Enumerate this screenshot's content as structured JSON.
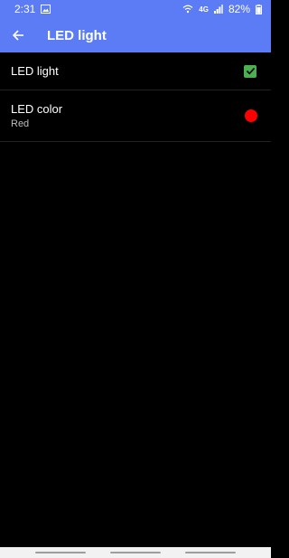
{
  "status_bar": {
    "time": "2:31",
    "network_label": "4G",
    "battery": "82%",
    "icons": [
      "image-icon",
      "wifi-icon",
      "signal-icon",
      "battery-icon"
    ]
  },
  "app_bar": {
    "title": "LED light",
    "back_icon": "arrow-left-icon"
  },
  "preferences": [
    {
      "title": "LED light",
      "type": "checkbox",
      "checked": true
    },
    {
      "title": "LED color",
      "summary": "Red",
      "type": "color"
    }
  ],
  "colors": {
    "app_bar": "#5b7cf4",
    "checkbox": "#4caf50",
    "led_color": "#ff0000",
    "background": "#000000"
  }
}
